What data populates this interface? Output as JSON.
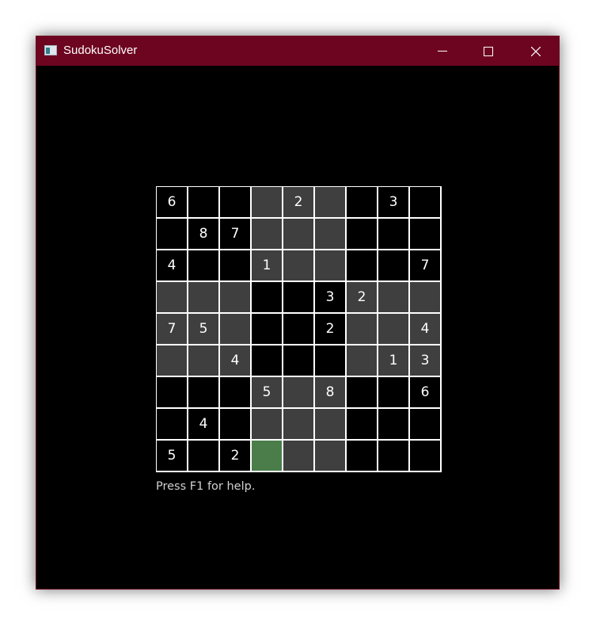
{
  "window": {
    "title": "SudokuSolver",
    "icon": "app-window-icon",
    "titlebar_color": "#6d0520",
    "controls": [
      "minimize-icon",
      "maximize-icon",
      "close-icon"
    ]
  },
  "board": {
    "size": 9,
    "rows": [
      [
        "6",
        "",
        "",
        "",
        "2",
        "",
        "",
        "3",
        ""
      ],
      [
        "",
        "8",
        "7",
        "",
        "",
        "",
        "",
        "",
        ""
      ],
      [
        "4",
        "",
        "",
        "1",
        "",
        "",
        "",
        "",
        "7"
      ],
      [
        "",
        "",
        "",
        "",
        "",
        "3",
        "2",
        "",
        ""
      ],
      [
        "7",
        "5",
        "",
        "",
        "",
        "2",
        "",
        "",
        "4"
      ],
      [
        "",
        "",
        "4",
        "",
        "",
        "",
        "",
        "1",
        "3"
      ],
      [
        "",
        "",
        "",
        "5",
        "",
        "8",
        "",
        "",
        "6"
      ],
      [
        "",
        "4",
        "",
        "",
        "",
        "",
        "",
        "",
        ""
      ],
      [
        "5",
        "",
        "2",
        "",
        "",
        "",
        "",
        "",
        ""
      ]
    ],
    "selected_cell": {
      "row": 8,
      "col": 3
    },
    "colors": {
      "cell": "#000000",
      "alt_box": "#3f3f3f",
      "selected": "#4a7d4a",
      "grid_lines": "#ffffff",
      "digits": "#ffffff"
    }
  },
  "status": {
    "help_text": "Press F1 for help."
  }
}
